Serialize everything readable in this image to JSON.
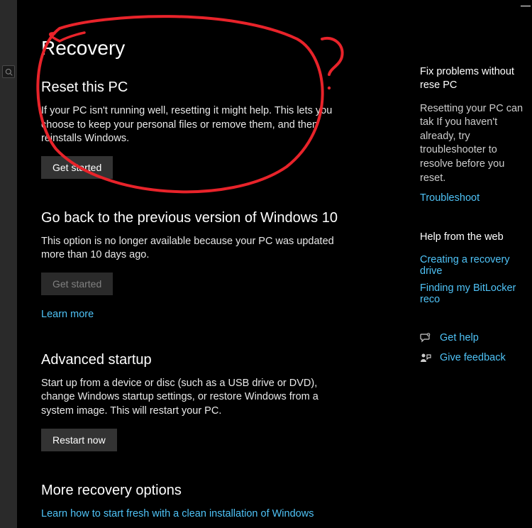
{
  "page_title": "Recovery",
  "sections": {
    "reset": {
      "heading": "Reset this PC",
      "body": "If your PC isn't running well, resetting it might help. This lets you choose to keep your personal files or remove them, and then reinstalls Windows.",
      "button": "Get started"
    },
    "goback": {
      "heading": "Go back to the previous version of Windows 10",
      "body": "This option is no longer available because your PC was updated more than 10 days ago.",
      "button": "Get started",
      "link": "Learn more"
    },
    "advanced": {
      "heading": "Advanced startup",
      "body": "Start up from a device or disc (such as a USB drive or DVD), change Windows startup settings, or restore Windows from a system image. This will restart your PC.",
      "button": "Restart now"
    },
    "more": {
      "heading": "More recovery options",
      "link": "Learn how to start fresh with a clean installation of Windows"
    }
  },
  "side": {
    "fix": {
      "heading": "Fix problems without rese PC",
      "body": "Resetting your PC can tak If you haven't already, try troubleshooter to resolve before you reset.",
      "link": "Troubleshoot"
    },
    "help": {
      "heading": "Help from the web",
      "link1": "Creating a recovery drive",
      "link2": "Finding my BitLocker reco"
    },
    "support": {
      "get_help": "Get help",
      "give_feedback": "Give feedback"
    }
  }
}
